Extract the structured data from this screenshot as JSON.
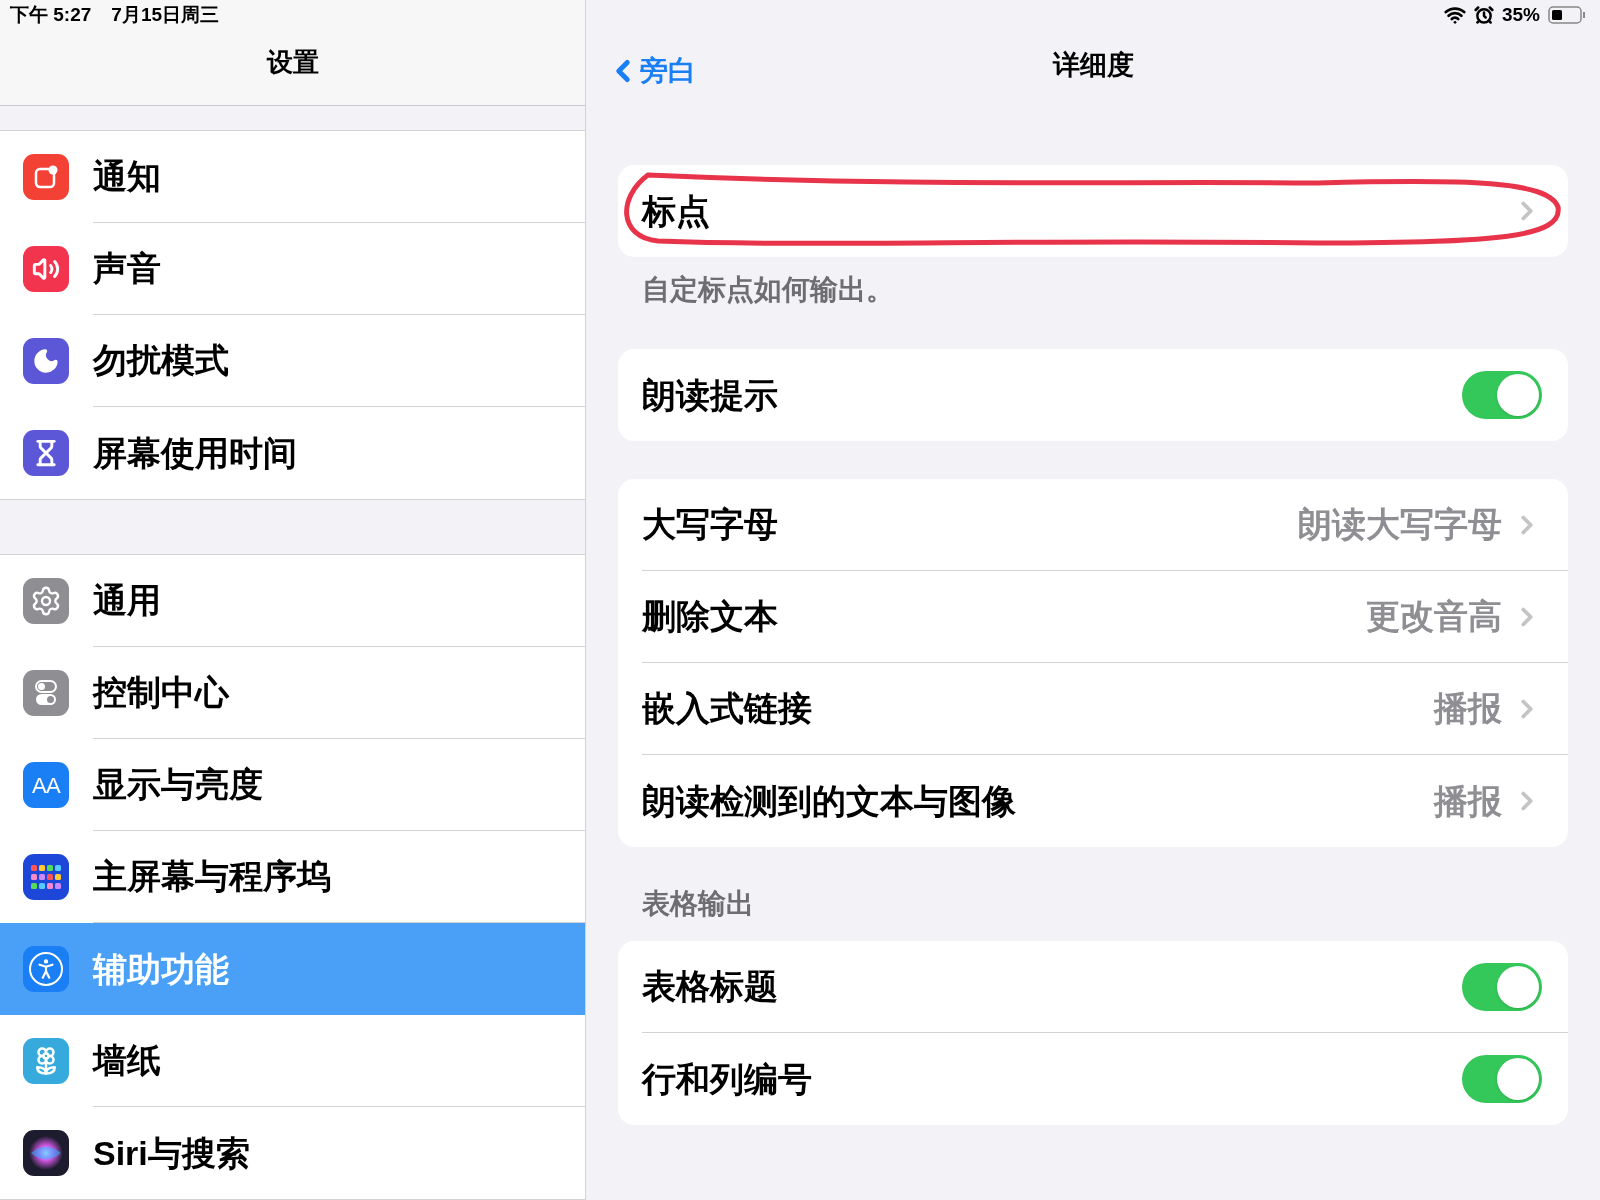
{
  "status_bar": {
    "time": "下午 5:27",
    "date": "7月15日周三",
    "battery": "35%"
  },
  "sidebar": {
    "title": "设置",
    "groups": [
      [
        {
          "label": "通知",
          "kind": "notifications",
          "color": "#f34235",
          "selected": false
        },
        {
          "label": "声音",
          "kind": "sound",
          "color": "#f2344f",
          "selected": false
        },
        {
          "label": "勿扰模式",
          "kind": "moon",
          "color": "#5b57d6",
          "selected": false
        },
        {
          "label": "屏幕使用时间",
          "kind": "hourglass",
          "color": "#5b57d6",
          "selected": false
        }
      ],
      [
        {
          "label": "通用",
          "kind": "gear",
          "color": "#8e8e93",
          "selected": false
        },
        {
          "label": "控制中心",
          "kind": "toggles",
          "color": "#8e8e93",
          "selected": false
        },
        {
          "label": "显示与亮度",
          "kind": "text",
          "glyph": "AA",
          "color": "#1a7ef5",
          "selected": false
        },
        {
          "label": "主屏幕与程序坞",
          "kind": "grid",
          "color": "#1d47d8",
          "selected": false
        },
        {
          "label": "辅助功能",
          "kind": "accessibility",
          "color": "#1a7ef5",
          "selected": true
        },
        {
          "label": "墙纸",
          "kind": "flower",
          "color": "#36aadc",
          "selected": false
        },
        {
          "label": "Siri与搜索",
          "kind": "siri",
          "color": "#1c1c2e",
          "selected": false
        }
      ]
    ]
  },
  "detail": {
    "back": "旁白",
    "title": "详细度",
    "sections": [
      {
        "rows": [
          {
            "kind": "link",
            "label": "标点",
            "circled": true
          }
        ],
        "footer": "自定标点如何输出。"
      },
      {
        "rows": [
          {
            "kind": "switch",
            "label": "朗读提示",
            "on": true
          }
        ]
      },
      {
        "rows": [
          {
            "kind": "link",
            "label": "大写字母",
            "value": "朗读大写字母"
          },
          {
            "kind": "link",
            "label": "删除文本",
            "value": "更改音高"
          },
          {
            "kind": "link",
            "label": "嵌入式链接",
            "value": "播报"
          },
          {
            "kind": "link",
            "label": "朗读检测到的文本与图像",
            "value": "播报"
          }
        ]
      },
      {
        "header": "表格输出",
        "rows": [
          {
            "kind": "switch",
            "label": "表格标题",
            "on": true
          },
          {
            "kind": "switch",
            "label": "行和列编号",
            "on": true
          }
        ]
      }
    ]
  }
}
